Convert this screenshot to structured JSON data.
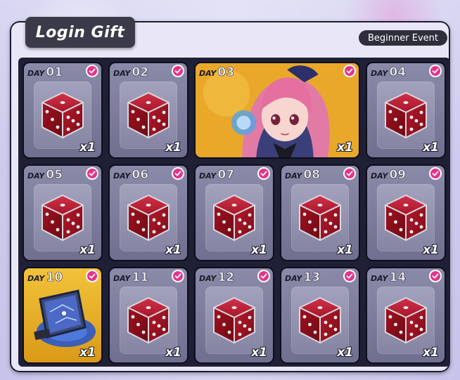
{
  "title": "Login Gift",
  "event_badge": "Beginner Event",
  "day_word": "DAY",
  "colors": {
    "accent_check": "#e6338a",
    "tile_normal": "#7a7a9a",
    "tile_special": "#e8ad28",
    "dice": "#9e1020"
  },
  "rewards": [
    {
      "day": "01",
      "item_icon": "red-dice-icon",
      "qty": "x1",
      "claimed": true
    },
    {
      "day": "02",
      "item_icon": "red-dice-icon",
      "qty": "x1",
      "claimed": true
    },
    {
      "day": "03",
      "item_icon": "pink-haired-character-portrait",
      "qty": "x1",
      "claimed": true
    },
    {
      "day": "04",
      "item_icon": "red-dice-icon",
      "qty": "x1",
      "claimed": true
    },
    {
      "day": "05",
      "item_icon": "red-dice-icon",
      "qty": "x1",
      "claimed": true
    },
    {
      "day": "06",
      "item_icon": "red-dice-icon",
      "qty": "x1",
      "claimed": true
    },
    {
      "day": "07",
      "item_icon": "red-dice-icon",
      "qty": "x1",
      "claimed": true
    },
    {
      "day": "08",
      "item_icon": "red-dice-icon",
      "qty": "x1",
      "claimed": true
    },
    {
      "day": "09",
      "item_icon": "red-dice-icon",
      "qty": "x1",
      "claimed": true
    },
    {
      "day": "10",
      "item_icon": "blue-card-device-icon",
      "qty": "x1",
      "claimed": true
    },
    {
      "day": "11",
      "item_icon": "red-dice-icon",
      "qty": "x1",
      "claimed": true
    },
    {
      "day": "12",
      "item_icon": "red-dice-icon",
      "qty": "x1",
      "claimed": true
    },
    {
      "day": "13",
      "item_icon": "red-dice-icon",
      "qty": "x1",
      "claimed": true
    },
    {
      "day": "14",
      "item_icon": "red-dice-icon",
      "qty": "x1",
      "claimed": true
    }
  ]
}
